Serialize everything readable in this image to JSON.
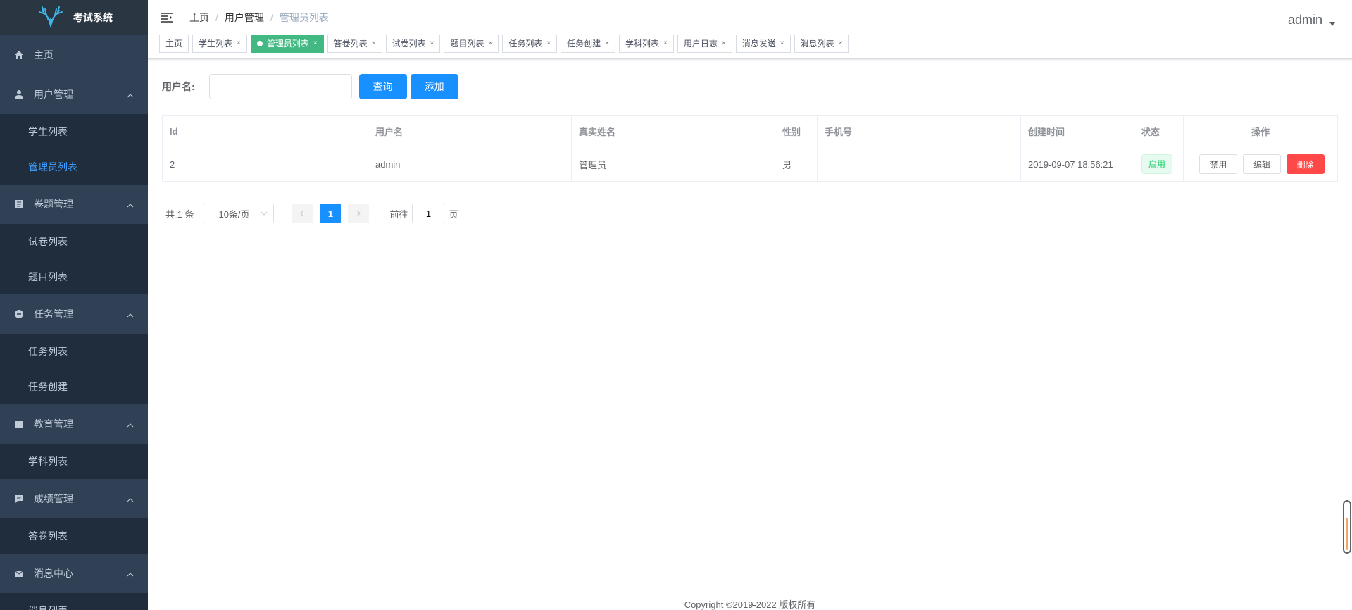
{
  "app": {
    "title": "考试系统"
  },
  "sidebar": {
    "groups": [
      {
        "label": "主页",
        "icon": "home-icon",
        "children": []
      },
      {
        "label": "用户管理",
        "icon": "user-icon",
        "children": [
          "学生列表",
          "管理员列表"
        ]
      },
      {
        "label": "卷题管理",
        "icon": "paper-icon",
        "children": [
          "试卷列表",
          "题目列表"
        ]
      },
      {
        "label": "任务管理",
        "icon": "task-icon",
        "children": [
          "任务列表",
          "任务创建"
        ]
      },
      {
        "label": "教育管理",
        "icon": "book-icon",
        "children": [
          "学科列表"
        ]
      },
      {
        "label": "成绩管理",
        "icon": "chat-icon",
        "children": [
          "答卷列表"
        ]
      },
      {
        "label": "消息中心",
        "icon": "mail-icon",
        "children": [
          "消息列表"
        ]
      }
    ],
    "active_item": "管理员列表"
  },
  "header": {
    "breadcrumb": [
      "主页",
      "用户管理",
      "管理员列表"
    ],
    "separator": "/",
    "username": "admin"
  },
  "tags": [
    {
      "label": "主页",
      "closable": false,
      "active": false
    },
    {
      "label": "学生列表",
      "closable": true,
      "active": false
    },
    {
      "label": "管理员列表",
      "closable": true,
      "active": true
    },
    {
      "label": "答卷列表",
      "closable": true,
      "active": false
    },
    {
      "label": "试卷列表",
      "closable": true,
      "active": false
    },
    {
      "label": "题目列表",
      "closable": true,
      "active": false
    },
    {
      "label": "任务列表",
      "closable": true,
      "active": false
    },
    {
      "label": "任务创建",
      "closable": true,
      "active": false
    },
    {
      "label": "学科列表",
      "closable": true,
      "active": false
    },
    {
      "label": "用户日志",
      "closable": true,
      "active": false
    },
    {
      "label": "消息发送",
      "closable": true,
      "active": false
    },
    {
      "label": "消息列表",
      "closable": true,
      "active": false
    }
  ],
  "search": {
    "label": "用户名:",
    "value": "",
    "query_button": "查询",
    "add_button": "添加"
  },
  "table": {
    "columns": [
      "Id",
      "用户名",
      "真实姓名",
      "性别",
      "手机号",
      "创建时间",
      "状态",
      "操作"
    ],
    "rows": [
      {
        "id": "2",
        "username": "admin",
        "realname": "管理员",
        "gender": "男",
        "phone": "",
        "created": "2019-09-07 18:56:21",
        "status": "启用",
        "actions": [
          "禁用",
          "编辑",
          "删除"
        ]
      }
    ]
  },
  "pagination": {
    "total_text": "共 1 条",
    "page_size": "10条/页",
    "current_page": "1",
    "goto_label": "前往",
    "goto_value": "1",
    "page_suffix": "页"
  },
  "footer": {
    "copyright": "Copyright ©2019-2022 版权所有"
  },
  "colors": {
    "sidebar_bg": "#304156",
    "submenu_bg": "#1f2d3d",
    "primary": "#1890ff",
    "active_tag": "#42b983",
    "danger": "#ff4949"
  }
}
